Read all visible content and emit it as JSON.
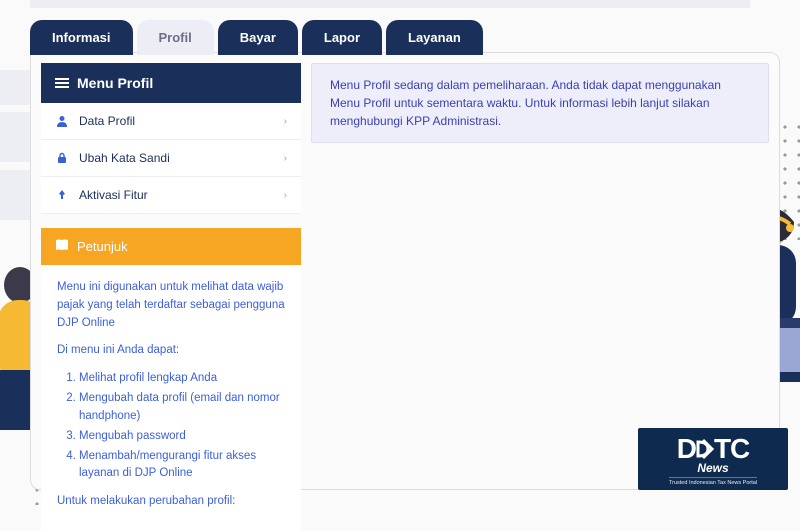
{
  "tabs": {
    "informasi": "Informasi",
    "profil": "Profil",
    "bayar": "Bayar",
    "lapor": "Lapor",
    "layanan": "Layanan"
  },
  "sidebar": {
    "header": "Menu Profil",
    "items": [
      {
        "label": "Data Profil"
      },
      {
        "label": "Ubah Kata Sandi"
      },
      {
        "label": "Aktivasi Fitur"
      }
    ]
  },
  "petunjuk": {
    "header": "Petunjuk",
    "intro": "Menu ini digunakan untuk melihat data wajib pajak yang telah terdaftar sebagai pengguna DJP Online",
    "lead": "Di menu ini Anda dapat:",
    "items": [
      "Melihat profil lengkap Anda",
      "Mengubah data profil (email dan nomor handphone)",
      "Mengubah password",
      "Menambah/mengurangi fitur akses layanan di DJP Online"
    ],
    "outro": "Untuk melakukan perubahan profil:"
  },
  "notice": "Menu Profil sedang dalam pemeliharaan. Anda tidak dapat menggunakan Menu Profil untuk sementara waktu. Untuk informasi lebih lanjut silakan menghubungi KPP Administrasi.",
  "logo": {
    "brand": "DDTC",
    "sub": "News",
    "tag": "Trusted Indonesian Tax News Portal"
  }
}
